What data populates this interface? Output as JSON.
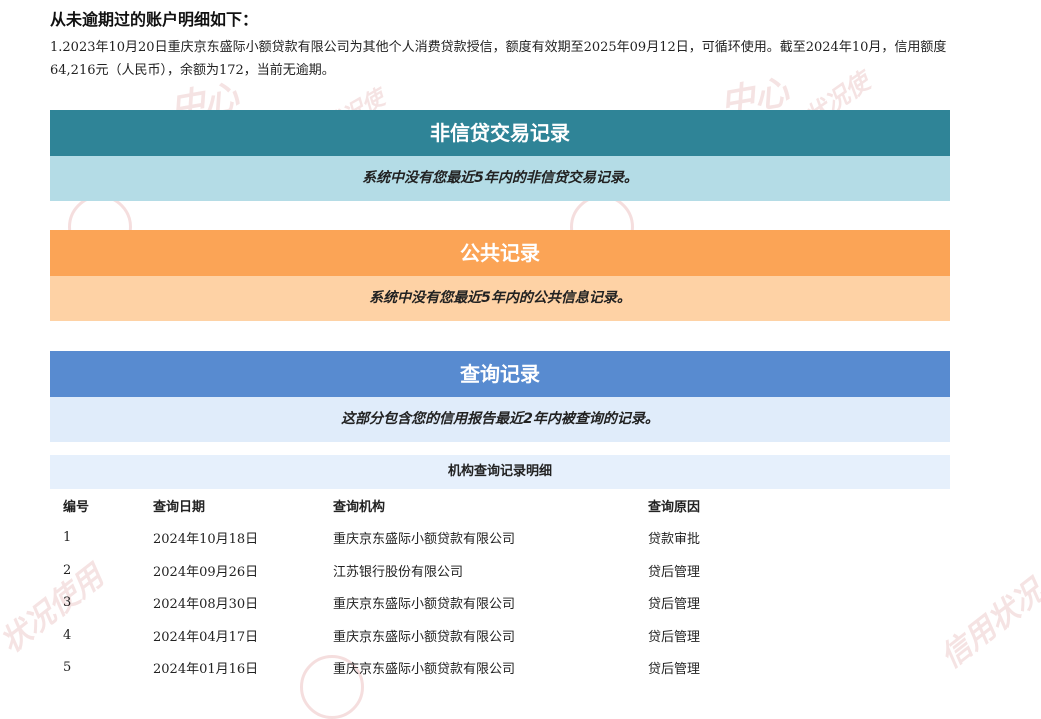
{
  "heading": "从未逾期过的账户明细如下：",
  "account_para": "1.2023年10月20日重庆京东盛际小额贷款有限公司为其他个人消费贷款授信，额度有效期至2025年09月12日，可循环使用。截至2024年10月，信用额度64,216元（人民币），余额为172，当前无逾期。",
  "sections": {
    "non_credit": {
      "title": "非信贷交易记录",
      "body": "系统中没有您最近5年内的非信贷交易记录。"
    },
    "public": {
      "title": "公共记录",
      "body": "系统中没有您最近5年内的公共信息记录。"
    },
    "query": {
      "title": "查询记录",
      "body": "这部分包含您的信用报告最近2年内被查询的记录。"
    }
  },
  "query_table": {
    "caption": "机构查询记录明细",
    "headers": [
      "编号",
      "查询日期",
      "查询机构",
      "查询原因"
    ],
    "rows": [
      [
        "1",
        "2024年10月18日",
        "重庆京东盛际小额贷款有限公司",
        "贷款审批"
      ],
      [
        "2",
        "2024年09月26日",
        "江苏银行股份有限公司",
        "贷后管理"
      ],
      [
        "3",
        "2024年08月30日",
        "重庆京东盛际小额贷款有限公司",
        "贷后管理"
      ],
      [
        "4",
        "2024年04月17日",
        "重庆京东盛际小额贷款有限公司",
        "贷后管理"
      ],
      [
        "5",
        "2024年01月16日",
        "重庆京东盛际小额贷款有限公司",
        "贷后管理"
      ]
    ]
  },
  "colors": {
    "non_credit_title": "#2f8497",
    "non_credit_body": "#b4dce6",
    "public_title": "#fba456",
    "public_body": "#fed2a5",
    "query_title": "#588bd0",
    "query_body": "#e0ecfa"
  }
}
